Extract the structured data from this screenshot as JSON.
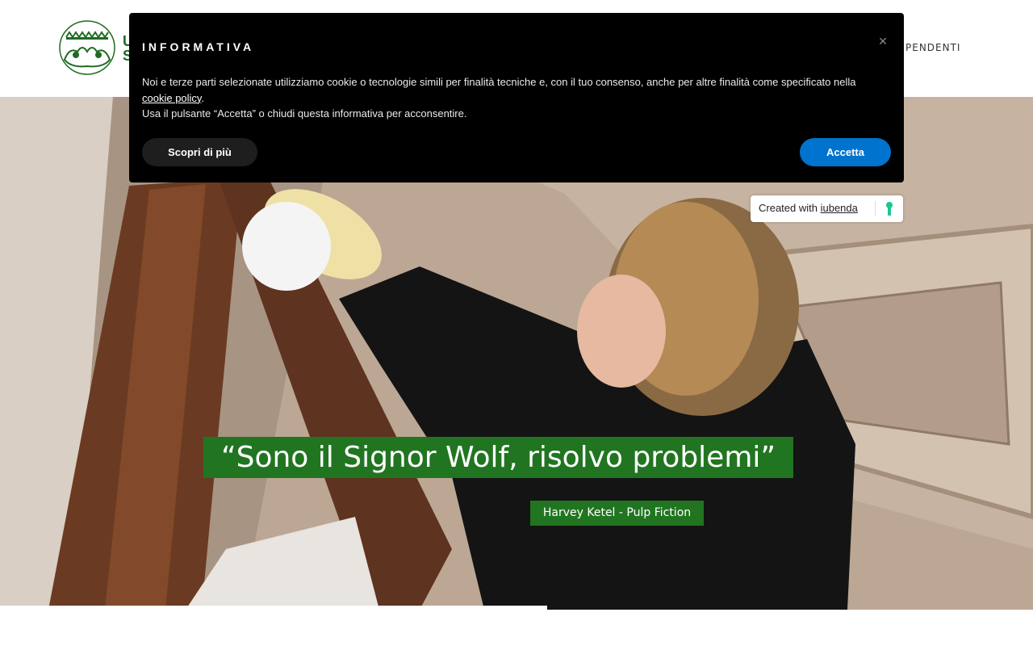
{
  "header": {
    "logo_icon": "crest-logo-icon",
    "logo_letters": "U S",
    "nav_partial": "PENDENTI"
  },
  "hero": {
    "quote": "“Sono il Signor Wolf, risolvo problemi”",
    "author": "Harvey Ketel - Pulp Fiction",
    "quote_bg_color": "#217521"
  },
  "cookie": {
    "title": "INFORMATIVA",
    "close_icon": "close-icon",
    "text_1": "Noi e terze parti selezionate utilizziamo cookie o tecnologie simili per finalità tecniche e, con il tuo consenso, anche per altre finalità come specificato nella ",
    "link": "cookie policy",
    "text_2": ".",
    "text_3": "Usa il pulsante “Accetta” o chiudi questa informativa per acconsentire.",
    "more_label": "Scopri di più",
    "accept_label": "Accetta",
    "accept_color": "#0073ce"
  },
  "iubenda": {
    "prefix": "Created with ",
    "brand": "iubenda",
    "icon": "iubenda-keyhole-icon"
  }
}
